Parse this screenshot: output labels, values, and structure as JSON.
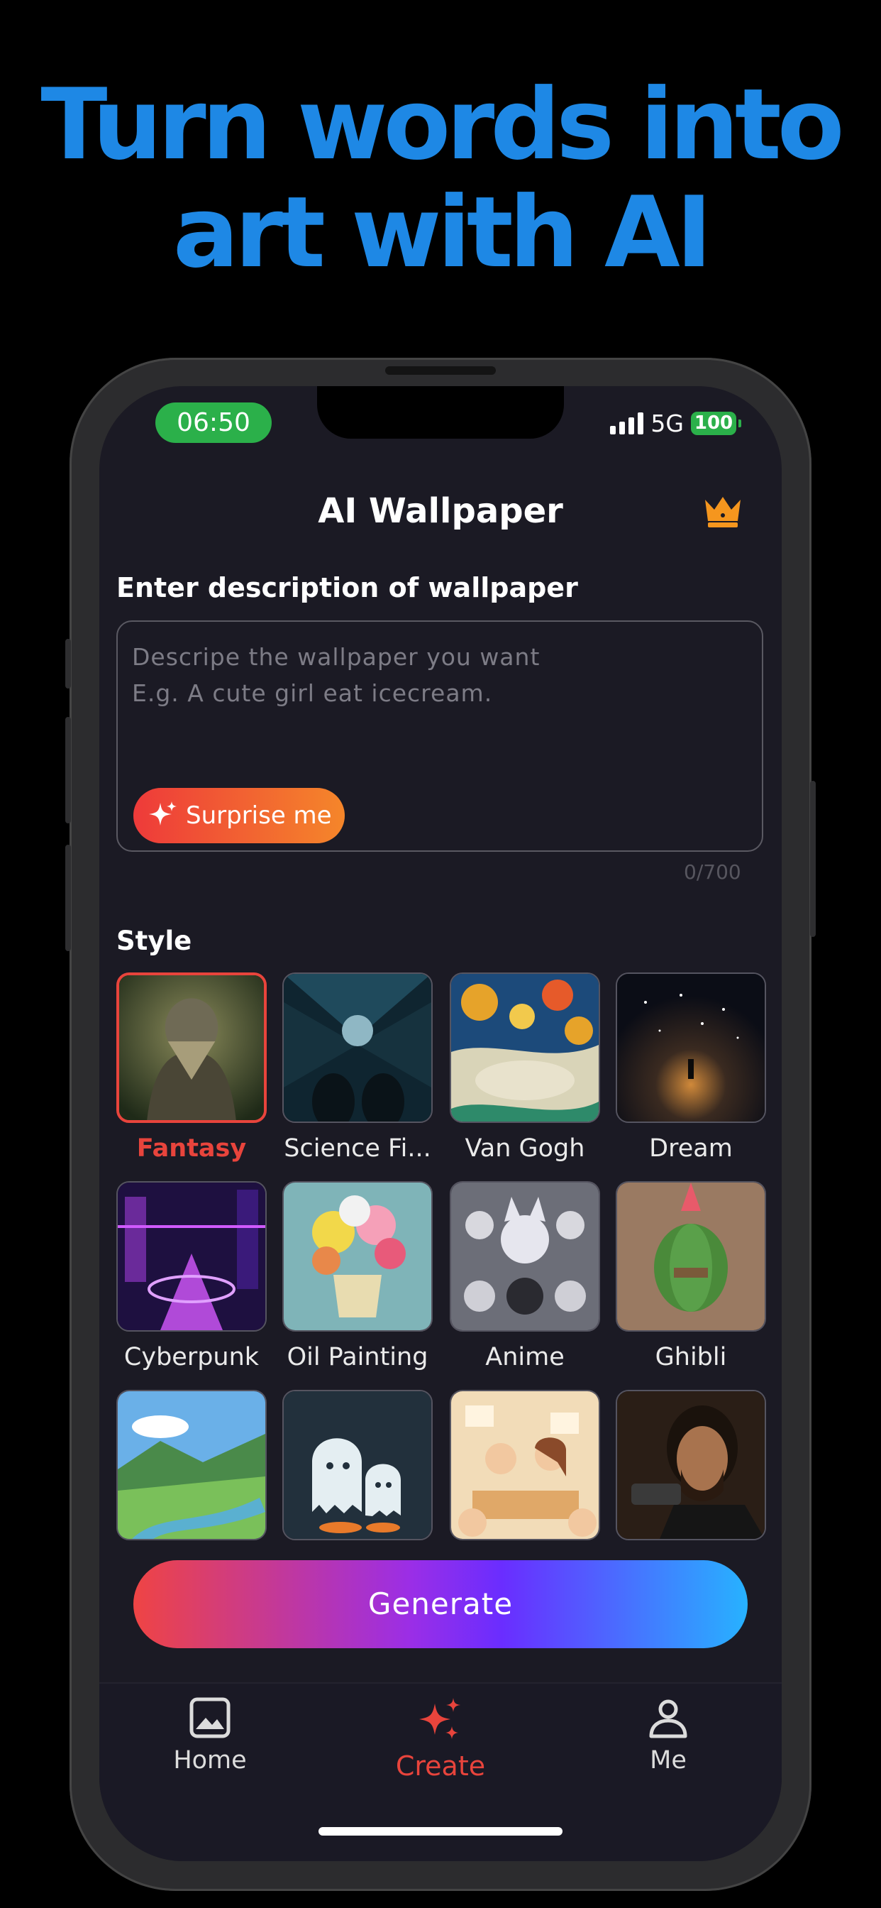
{
  "headline": {
    "line1": "Turn words into",
    "line2": "art with AI"
  },
  "status_bar": {
    "time": "06:50",
    "network": "5G",
    "battery": "100"
  },
  "header": {
    "title": "AI Wallpaper",
    "premium_icon": "crown-icon"
  },
  "description": {
    "label": "Enter description of wallpaper",
    "placeholder": "Descripe the wallpaper you want\nE.g. A cute girl eat icecream.",
    "surprise_label": "Surprise me",
    "counter": "0/700"
  },
  "style": {
    "label": "Style",
    "items": [
      {
        "label": "Fantasy",
        "selected": true
      },
      {
        "label": "Science Fi..."
      },
      {
        "label": "Van Gogh"
      },
      {
        "label": "Dream"
      },
      {
        "label": "Cyberpunk"
      },
      {
        "label": "Oil Painting"
      },
      {
        "label": "Anime"
      },
      {
        "label": "Ghibli"
      },
      {
        "label": ""
      },
      {
        "label": ""
      },
      {
        "label": ""
      },
      {
        "label": ""
      }
    ]
  },
  "generate_label": "Generate",
  "tabs": [
    {
      "label": "Home",
      "icon": "image-icon"
    },
    {
      "label": "Create",
      "icon": "sparkles-icon",
      "active": true
    },
    {
      "label": "Me",
      "icon": "person-icon"
    }
  ],
  "colors": {
    "accent": "#e8443c",
    "headline": "#1E88E5",
    "status_green": "#2bb04a"
  }
}
